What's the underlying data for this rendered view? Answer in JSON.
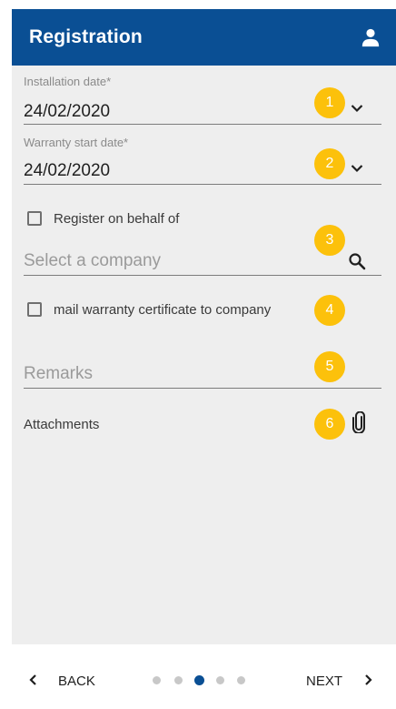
{
  "header": {
    "title": "Registration",
    "account_icon": "account-icon"
  },
  "form": {
    "installation_date": {
      "label": "Installation date*",
      "value": "24/02/2020"
    },
    "warranty_start_date": {
      "label": "Warranty start date*",
      "value": "24/02/2020"
    },
    "register_on_behalf": {
      "label": "Register on behalf of",
      "checked": false
    },
    "company": {
      "placeholder": "Select a company"
    },
    "mail_certificate": {
      "label": "mail warranty certificate to company",
      "checked": false
    },
    "remarks": {
      "placeholder": "Remarks"
    },
    "attachments": {
      "label": "Attachments"
    }
  },
  "badges": [
    "1",
    "2",
    "3",
    "4",
    "5",
    "6"
  ],
  "footer": {
    "back_label": "BACK",
    "next_label": "NEXT",
    "page_count": 5,
    "active_page": 3
  },
  "colors": {
    "primary": "#0a4f94",
    "badge": "#fcc10b",
    "background": "#eeeeee"
  }
}
